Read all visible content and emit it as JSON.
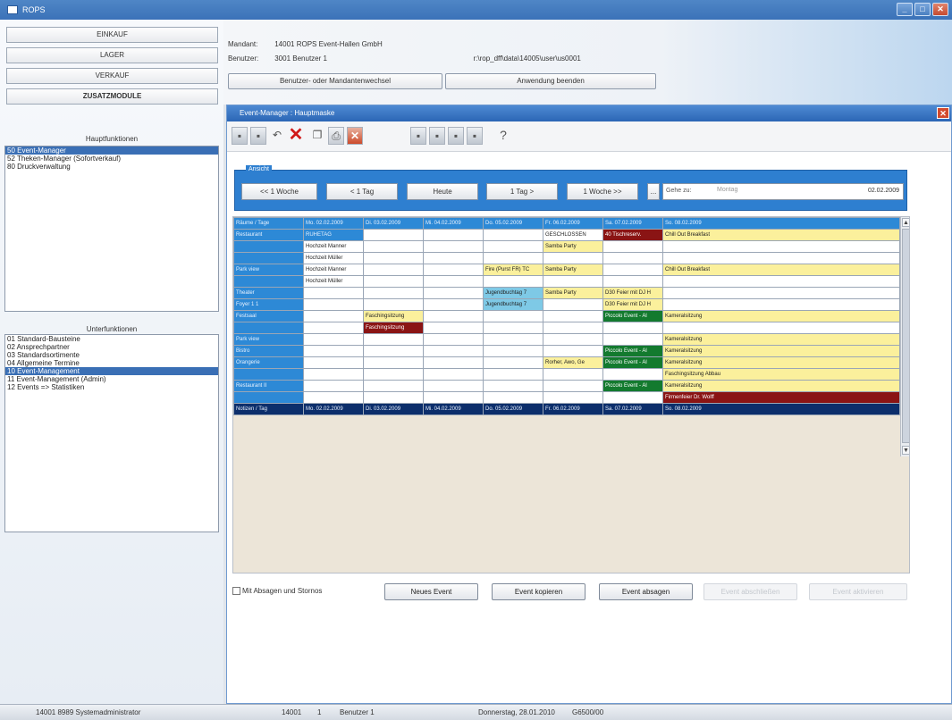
{
  "window": {
    "title": "ROPS"
  },
  "menu": {
    "buttons": [
      {
        "label": "EINKAUF",
        "bold": false
      },
      {
        "label": "LAGER",
        "bold": false
      },
      {
        "label": "VERKAUF",
        "bold": false
      },
      {
        "label": "ZUSATZMODULE",
        "bold": true
      }
    ],
    "hauptfunktionen_title": "Hauptfunktionen",
    "hauptfunktionen": [
      {
        "label": "50 Event-Manager",
        "selected": true
      },
      {
        "label": "52 Theken-Manager (Sofortverkauf)",
        "selected": false
      },
      {
        "label": "80 Druckverwaltung",
        "selected": false
      }
    ],
    "unterfunktionen_title": "Unterfunktionen",
    "unterfunktionen": [
      {
        "label": "01 Standard-Bausteine",
        "selected": false
      },
      {
        "label": "02 Ansprechpartner",
        "selected": false
      },
      {
        "label": "03 Standardsortimente",
        "selected": false
      },
      {
        "label": "04 Allgemeine Termine",
        "selected": false
      },
      {
        "label": "10 Event-Management",
        "selected": true
      },
      {
        "label": "11 Event-Management (Admin)",
        "selected": false
      },
      {
        "label": "12 Events => Statistiken",
        "selected": false
      }
    ]
  },
  "header": {
    "mandant_label": "Mandant:",
    "mandant_value": "14001 ROPS Event-Hallen GmbH",
    "benutzer_label": "Benutzer:",
    "benutzer_value": "3001 Benutzer 1",
    "path": "r:\\rop_dff\\data\\14005\\user\\us0001",
    "switch_button": "Benutzer- oder Mandantenwechsel",
    "exit_button": "Anwendung beenden"
  },
  "subwindow": {
    "title": "Event-Manager : Hauptmaske",
    "toolbar_icons": [
      "save-icon",
      "save-as-icon",
      "undo-icon",
      "delete-icon",
      "copy-icon",
      "print-icon",
      "close-icon",
      "first-icon",
      "prev-icon",
      "next-icon",
      "last-icon",
      "help-icon"
    ],
    "ansicht_label": "Ansicht",
    "nav": {
      "back_week": "<< 1 Woche",
      "back_day": "< 1 Tag",
      "today": "Heute",
      "fwd_day": "1 Tag >",
      "fwd_week": "1 Woche >>",
      "dots": "...",
      "goto_label": "Gehe zu:",
      "goto_placeholder": "Montag",
      "goto_value": "02.02.2009"
    },
    "grid": {
      "header": [
        "Räume / Tage",
        "Mo. 02.02.2009",
        "Di. 03.02.2009",
        "Mi. 04.02.2009",
        "Do. 05.02.2009",
        "Fr. 06.02.2009",
        "Sa. 07.02.2009",
        "So. 08.02.2009"
      ],
      "rows": [
        [
          {
            "t": "Restaurant",
            "c": "bl"
          },
          {
            "t": "RUHETAG",
            "c": "bl"
          },
          {
            "t": "",
            "c": ""
          },
          {
            "t": "",
            "c": ""
          },
          {
            "t": "",
            "c": ""
          },
          {
            "t": "GESCHLOSSEN",
            "c": ""
          },
          {
            "t": "40 Tischreserv.",
            "c": "rd"
          },
          {
            "t": "Chill Out Breakfast",
            "c": "ye"
          }
        ],
        [
          {
            "t": "",
            "c": "bl"
          },
          {
            "t": "Hochzeit Manner",
            "c": ""
          },
          {
            "t": "",
            "c": ""
          },
          {
            "t": "",
            "c": ""
          },
          {
            "t": "",
            "c": ""
          },
          {
            "t": "Samba Party",
            "c": "ye"
          },
          {
            "t": "",
            "c": ""
          },
          {
            "t": "",
            "c": ""
          }
        ],
        [
          {
            "t": "",
            "c": "bl"
          },
          {
            "t": "Hochzeit Müller",
            "c": ""
          },
          {
            "t": "",
            "c": ""
          },
          {
            "t": "",
            "c": ""
          },
          {
            "t": "",
            "c": ""
          },
          {
            "t": "",
            "c": ""
          },
          {
            "t": "",
            "c": ""
          },
          {
            "t": "",
            "c": ""
          }
        ],
        [
          {
            "t": "Park view",
            "c": "bl"
          },
          {
            "t": "Hochzeit Manner",
            "c": ""
          },
          {
            "t": "",
            "c": ""
          },
          {
            "t": "",
            "c": ""
          },
          {
            "t": "Fire (Purst FR) TC",
            "c": "ye"
          },
          {
            "t": "Samba Party",
            "c": "ye"
          },
          {
            "t": "",
            "c": ""
          },
          {
            "t": "Chill Out Breakfast",
            "c": "ye"
          }
        ],
        [
          {
            "t": "",
            "c": "bl"
          },
          {
            "t": "Hochzeit Müller",
            "c": ""
          },
          {
            "t": "",
            "c": ""
          },
          {
            "t": "",
            "c": ""
          },
          {
            "t": "",
            "c": ""
          },
          {
            "t": "",
            "c": ""
          },
          {
            "t": "",
            "c": ""
          },
          {
            "t": "",
            "c": ""
          }
        ],
        [
          {
            "t": "Theater",
            "c": "bl"
          },
          {
            "t": "",
            "c": ""
          },
          {
            "t": "",
            "c": ""
          },
          {
            "t": "",
            "c": ""
          },
          {
            "t": "Jugendbuchtag 7",
            "c": "lb"
          },
          {
            "t": "Samba Party",
            "c": "ye"
          },
          {
            "t": "D30 Feier mit DJ H",
            "c": "ye"
          },
          {
            "t": "",
            "c": ""
          }
        ],
        [
          {
            "t": "Foyer 1 1",
            "c": "bl"
          },
          {
            "t": "",
            "c": ""
          },
          {
            "t": "",
            "c": ""
          },
          {
            "t": "",
            "c": ""
          },
          {
            "t": "Jugendbuchtag 7",
            "c": "lb"
          },
          {
            "t": "",
            "c": ""
          },
          {
            "t": "D30 Feier mit DJ H",
            "c": "ye"
          },
          {
            "t": "",
            "c": ""
          }
        ],
        [
          {
            "t": "Festsaal",
            "c": "bl"
          },
          {
            "t": "",
            "c": ""
          },
          {
            "t": "Faschingsitzung",
            "c": "ye"
          },
          {
            "t": "",
            "c": ""
          },
          {
            "t": "",
            "c": ""
          },
          {
            "t": "",
            "c": ""
          },
          {
            "t": "Piccolo Event - Al",
            "c": "gr"
          },
          {
            "t": "Kameralsitzung",
            "c": "ye"
          }
        ],
        [
          {
            "t": "",
            "c": "bl"
          },
          {
            "t": "",
            "c": ""
          },
          {
            "t": "Faschingsitzung",
            "c": "rd"
          },
          {
            "t": "",
            "c": ""
          },
          {
            "t": "",
            "c": ""
          },
          {
            "t": "",
            "c": ""
          },
          {
            "t": "",
            "c": ""
          },
          {
            "t": "",
            "c": ""
          }
        ],
        [
          {
            "t": "Park view",
            "c": "bl"
          },
          {
            "t": "",
            "c": ""
          },
          {
            "t": "",
            "c": ""
          },
          {
            "t": "",
            "c": ""
          },
          {
            "t": "",
            "c": ""
          },
          {
            "t": "",
            "c": ""
          },
          {
            "t": "",
            "c": ""
          },
          {
            "t": "Kameralsitzung",
            "c": "ye"
          }
        ],
        [
          {
            "t": "Bistro",
            "c": "bl"
          },
          {
            "t": "",
            "c": ""
          },
          {
            "t": "",
            "c": ""
          },
          {
            "t": "",
            "c": ""
          },
          {
            "t": "",
            "c": ""
          },
          {
            "t": "",
            "c": ""
          },
          {
            "t": "Piccolo Event - Al",
            "c": "gr"
          },
          {
            "t": "Kameralsitzung",
            "c": "ye"
          }
        ],
        [
          {
            "t": "Orangerie",
            "c": "bl"
          },
          {
            "t": "",
            "c": ""
          },
          {
            "t": "",
            "c": ""
          },
          {
            "t": "",
            "c": ""
          },
          {
            "t": "",
            "c": ""
          },
          {
            "t": "Rorher, Awo, Ge",
            "c": "ye"
          },
          {
            "t": "Piccolo Event - Al",
            "c": "gr"
          },
          {
            "t": "Kameralsitzung",
            "c": "ye"
          }
        ],
        [
          {
            "t": "",
            "c": "bl"
          },
          {
            "t": "",
            "c": ""
          },
          {
            "t": "",
            "c": ""
          },
          {
            "t": "",
            "c": ""
          },
          {
            "t": "",
            "c": ""
          },
          {
            "t": "",
            "c": ""
          },
          {
            "t": "",
            "c": ""
          },
          {
            "t": "Faschingsitzung Abbau",
            "c": "ye"
          }
        ],
        [
          {
            "t": "Restaurant II",
            "c": "bl"
          },
          {
            "t": "",
            "c": ""
          },
          {
            "t": "",
            "c": ""
          },
          {
            "t": "",
            "c": ""
          },
          {
            "t": "",
            "c": ""
          },
          {
            "t": "",
            "c": ""
          },
          {
            "t": "Piccolo Event - Al",
            "c": "gr"
          },
          {
            "t": "Kameralsitzung",
            "c": "ye"
          }
        ],
        [
          {
            "t": "",
            "c": "bl"
          },
          {
            "t": "",
            "c": ""
          },
          {
            "t": "",
            "c": ""
          },
          {
            "t": "",
            "c": ""
          },
          {
            "t": "",
            "c": ""
          },
          {
            "t": "",
            "c": ""
          },
          {
            "t": "",
            "c": ""
          },
          {
            "t": "Firmenfeier Dr. Wolff",
            "c": "rd"
          }
        ]
      ],
      "footer": [
        "Notizen / Tag",
        "Mo. 02.02.2009",
        "Di. 03.02.2009",
        "Mi. 04.02.2009",
        "Do. 05.02.2009",
        "Fr. 06.02.2009",
        "Sa. 07.02.2009",
        "So. 08.02.2009"
      ]
    },
    "bottom": {
      "checkbox_label": "Mit Absagen und Stornos",
      "new_event": "Neues Event",
      "copy_event": "Event kopieren",
      "cancel_event": "Event absagen",
      "complete_event": "Event abschließen",
      "activate_event": "Event aktivieren"
    }
  },
  "statusbar": {
    "left": "14001    8989    Systemadministrator",
    "mandant": "14001",
    "user_no": "1",
    "user": "Benutzer 1",
    "date": "Donnerstag, 28.01.2010",
    "code": "G6500/00"
  }
}
